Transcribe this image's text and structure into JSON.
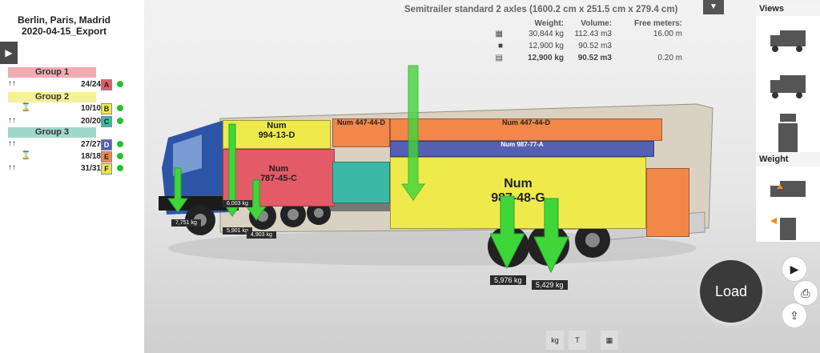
{
  "project": {
    "name": "Berlin, Paris, Madrid",
    "file": "2020-04-15_Export"
  },
  "groups": [
    {
      "label": "Group 1",
      "color": "#f2aab3",
      "rows": [
        {
          "count": "24/24",
          "letter": "A",
          "color": "#e25b67"
        }
      ]
    },
    {
      "label": "Group 2",
      "color": "#f5f19a",
      "rows": [
        {
          "count": "10/10",
          "letter": "B",
          "color": "#eeea4c"
        },
        {
          "count": "20/20",
          "letter": "C",
          "color": "#3bb8a6"
        }
      ]
    },
    {
      "label": "Group 3",
      "color": "#9fd8ca",
      "rows": [
        {
          "count": "27/27",
          "letter": "D",
          "color": "#5460b2"
        },
        {
          "count": "18/18",
          "letter": "E",
          "color": "#f2874a"
        },
        {
          "count": "31/31",
          "letter": "F",
          "color": "#e8e84c"
        }
      ]
    }
  ],
  "header": {
    "title": "Semitrailer standard 2 axles (1600.2 cm x 251.5 cm x 279.4 cm)",
    "col_weight": "Weight:",
    "col_volume": "Volume:",
    "col_free": "Free meters:",
    "rows": [
      {
        "weight": "30,844 kg",
        "volume": "112.43 m3",
        "free": "16.00 m"
      },
      {
        "weight": "12,900 kg",
        "volume": "90.52 m3",
        "free": ""
      },
      {
        "weight": "12,900 kg",
        "volume": "90.52 m3",
        "free": "0.20 m"
      }
    ]
  },
  "right_panel": {
    "views_label": "Views",
    "weight_label": "Weight"
  },
  "load_label": "Load",
  "axle_weights": [
    "5,976 kg",
    "5,429 kg"
  ],
  "small_weights": [
    "7,751 kg",
    "6,003 kg",
    "5,901 kg",
    "4,903 kg"
  ],
  "box_labels": {
    "a": "Num\n787-45-C",
    "b": "Num\n994-13-D",
    "c": "Num 447-44-D",
    "d": "Num 987-77-A",
    "e": "Num\n987-48-G"
  },
  "bottom_icons": [
    "kg",
    "T",
    "grid"
  ]
}
